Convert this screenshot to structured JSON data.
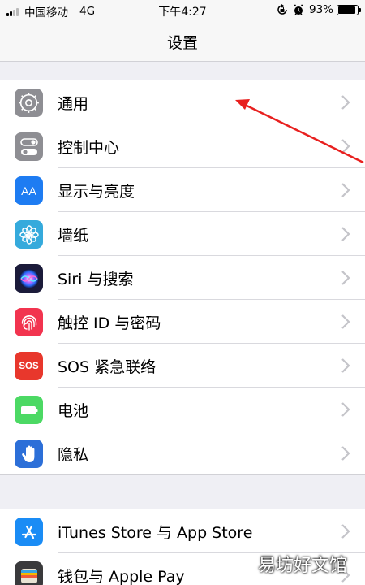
{
  "status_bar": {
    "carrier": "中国移动",
    "network": "4G",
    "time": "下午4:27",
    "battery_percent": "93%",
    "battery_level": 0.93,
    "icons": [
      "signal-icon",
      "rotation-lock-icon",
      "alarm-icon",
      "battery-icon"
    ]
  },
  "nav": {
    "title": "设置"
  },
  "groups": [
    {
      "rows": [
        {
          "label": "通用",
          "icon": "gear-icon",
          "color": "#8e8e93"
        },
        {
          "label": "控制中心",
          "icon": "toggles-icon",
          "color": "#8e8e93"
        },
        {
          "label": "显示与亮度",
          "icon": "aa-icon",
          "icon_text": "AA",
          "color": "#1e7cf2"
        },
        {
          "label": "墙纸",
          "icon": "flower-icon",
          "color": "#35aadc"
        },
        {
          "label": "Siri 与搜索",
          "icon": "siri-icon",
          "color": "#1b1b3a"
        },
        {
          "label": "触控 ID 与密码",
          "icon": "fingerprint-icon",
          "color": "#f2344f"
        },
        {
          "label": "SOS 紧急联络",
          "icon": "sos-icon",
          "icon_text": "SOS",
          "color": "#e8372c"
        },
        {
          "label": "电池",
          "icon": "battery-icon",
          "color": "#4cd964"
        },
        {
          "label": "隐私",
          "icon": "hand-icon",
          "color": "#2c6fd8"
        }
      ]
    },
    {
      "rows": [
        {
          "label": "iTunes Store 与 App Store",
          "icon": "app-store-icon",
          "color": "#1a8cf5"
        },
        {
          "label": "钱包与 Apple Pay",
          "icon": "wallet-icon",
          "color": "#3a3a3c"
        }
      ]
    }
  ],
  "annotation": {
    "arrow_color": "#e8201f"
  },
  "watermark": "易坊好文馆"
}
